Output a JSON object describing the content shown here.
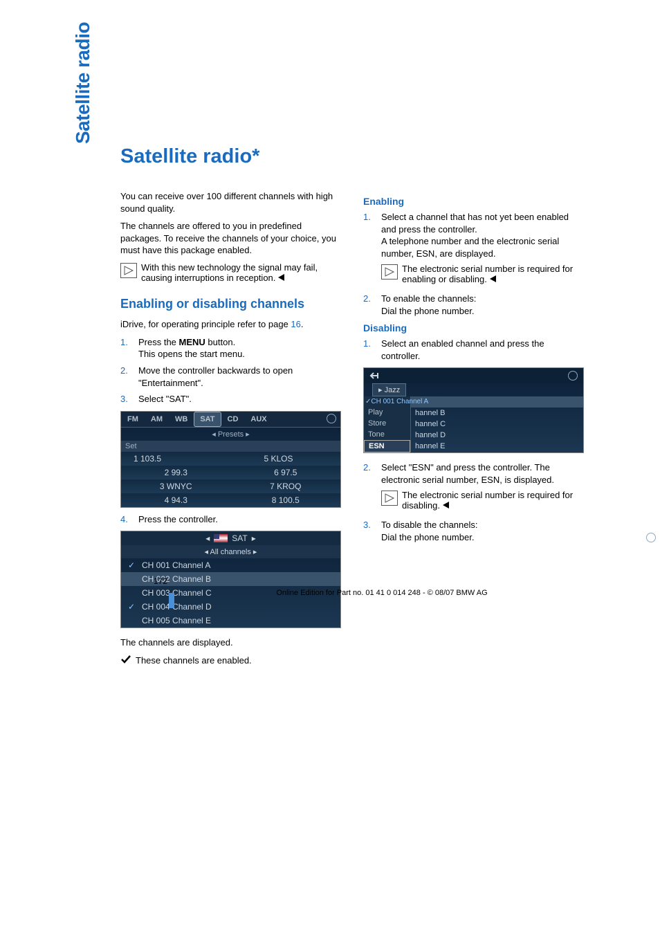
{
  "side_tab": "Satellite radio",
  "title": "Satellite radio",
  "asterisk": "*",
  "col1": {
    "intro1": "You can receive over 100 different channels with high sound quality.",
    "intro2": "The channels are offered to you in predefined packages. To receive the channels of your choice, you must have this package enabled.",
    "note1": "With this new technology the signal may fail, causing interruptions in reception.",
    "h2": "Enabling or disabling channels",
    "idrive_text_a": "iDrive, for operating principle refer to page ",
    "idrive_page": "16",
    "idrive_text_b": ".",
    "steps": [
      {
        "n": "1.",
        "text_a": "Press the ",
        "menu": "MENU",
        "text_b": " button.\nThis opens the start menu."
      },
      {
        "n": "2.",
        "text_a": "Move the controller backwards to open \"Entertainment\"."
      },
      {
        "n": "3.",
        "text_a": "Select \"SAT\"."
      }
    ],
    "ui1": {
      "tabs": [
        "FM",
        "AM",
        "WB",
        "SAT",
        "CD",
        "AUX"
      ],
      "active_tab": "SAT",
      "presets_label": "Presets",
      "set_label": "Set",
      "cells": [
        "1 103.5",
        "5 KLOS",
        "2 99.3",
        "6 97.5",
        "3 WNYC",
        "7 KROQ",
        "4 94.3",
        "8 100.5"
      ]
    },
    "step4": {
      "n": "4.",
      "text_a": "Press the controller."
    },
    "ui2": {
      "top": "SAT",
      "sub": "All channels",
      "rows": [
        {
          "check": true,
          "label": "CH 001 Channel A",
          "hl": false
        },
        {
          "check": false,
          "label": "CH 002 Channel B",
          "hl": true
        },
        {
          "check": false,
          "label": "CH 003 Channel C",
          "hl": false
        },
        {
          "check": true,
          "label": "CH 004 Channel D",
          "hl": false
        },
        {
          "check": false,
          "label": "CH 005 Channel E",
          "hl": false
        }
      ]
    },
    "displayed": "The channels are displayed.",
    "enabled_line": "These channels are enabled."
  },
  "col2": {
    "enabling_h": "Enabling",
    "en_steps": [
      {
        "n": "1.",
        "text": "Select a channel that has not yet been enabled and press the controller.\nA telephone number and the electronic serial number, ESN, are displayed."
      }
    ],
    "en_note": "The electronic serial number is required for enabling or disabling.",
    "en_step2": {
      "n": "2.",
      "text": "To enable the channels:\nDial the phone number."
    },
    "disabling_h": "Disabling",
    "dis_step1": {
      "n": "1.",
      "text": "Select an enabled channel and press the controller."
    },
    "ui3": {
      "tab": "Jazz",
      "left": [
        "Play",
        "Store",
        "Tone",
        "ESN"
      ],
      "selected_left": "ESN",
      "right_top": "CH 001 Channel A",
      "right": [
        "hannel B",
        "hannel C",
        "hannel D",
        "hannel E"
      ]
    },
    "dis_step2": {
      "n": "2.",
      "text": "Select \"ESN\" and press the controller. The electronic serial number, ESN, is displayed."
    },
    "dis_note": "The electronic serial number is required for disabling.",
    "dis_step3": {
      "n": "3.",
      "text": "To disable the channels:\nDial the phone number."
    }
  },
  "footer": {
    "page": "172",
    "copy": "Online Edition for Part no. 01 41 0 014 248 - © 08/07 BMW AG"
  }
}
